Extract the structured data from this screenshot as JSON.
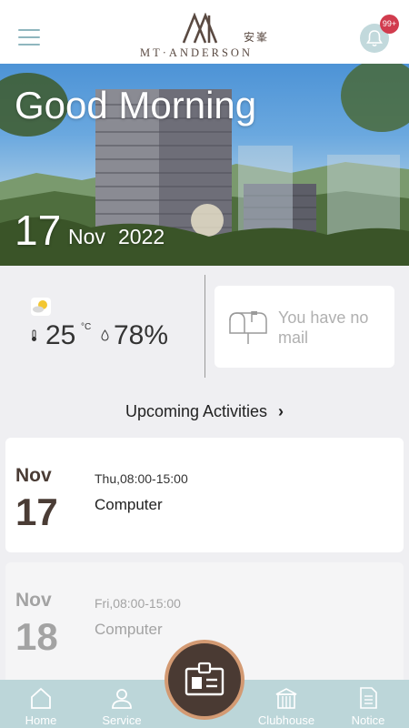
{
  "header": {
    "brand_chinese": "安峯",
    "brand_name": "MT·ANDERSON",
    "notification_badge": "99+"
  },
  "hero": {
    "greeting": "Good Morning",
    "day": "17",
    "month": "Nov",
    "year": "2022"
  },
  "weather": {
    "temperature": "25",
    "temperature_unit": "°C",
    "humidity": "78%"
  },
  "mail": {
    "message": "You have no mail"
  },
  "activities": {
    "heading": "Upcoming Activities",
    "items": [
      {
        "month": "Nov",
        "day": "17",
        "time": "Thu,08:00-15:00",
        "name": "Computer"
      },
      {
        "month": "Nov",
        "day": "18",
        "time": "Fri,08:00-15:00",
        "name": "Computer"
      }
    ]
  },
  "nav": {
    "home": "Home",
    "service": "Service",
    "clubhouse": "Clubhouse",
    "notice": "Notice"
  },
  "colors": {
    "accent_teal": "#bcd6d9",
    "brand_brown": "#4a3a33",
    "fab_ring": "#d39a73",
    "badge_red": "#d13c4e"
  }
}
